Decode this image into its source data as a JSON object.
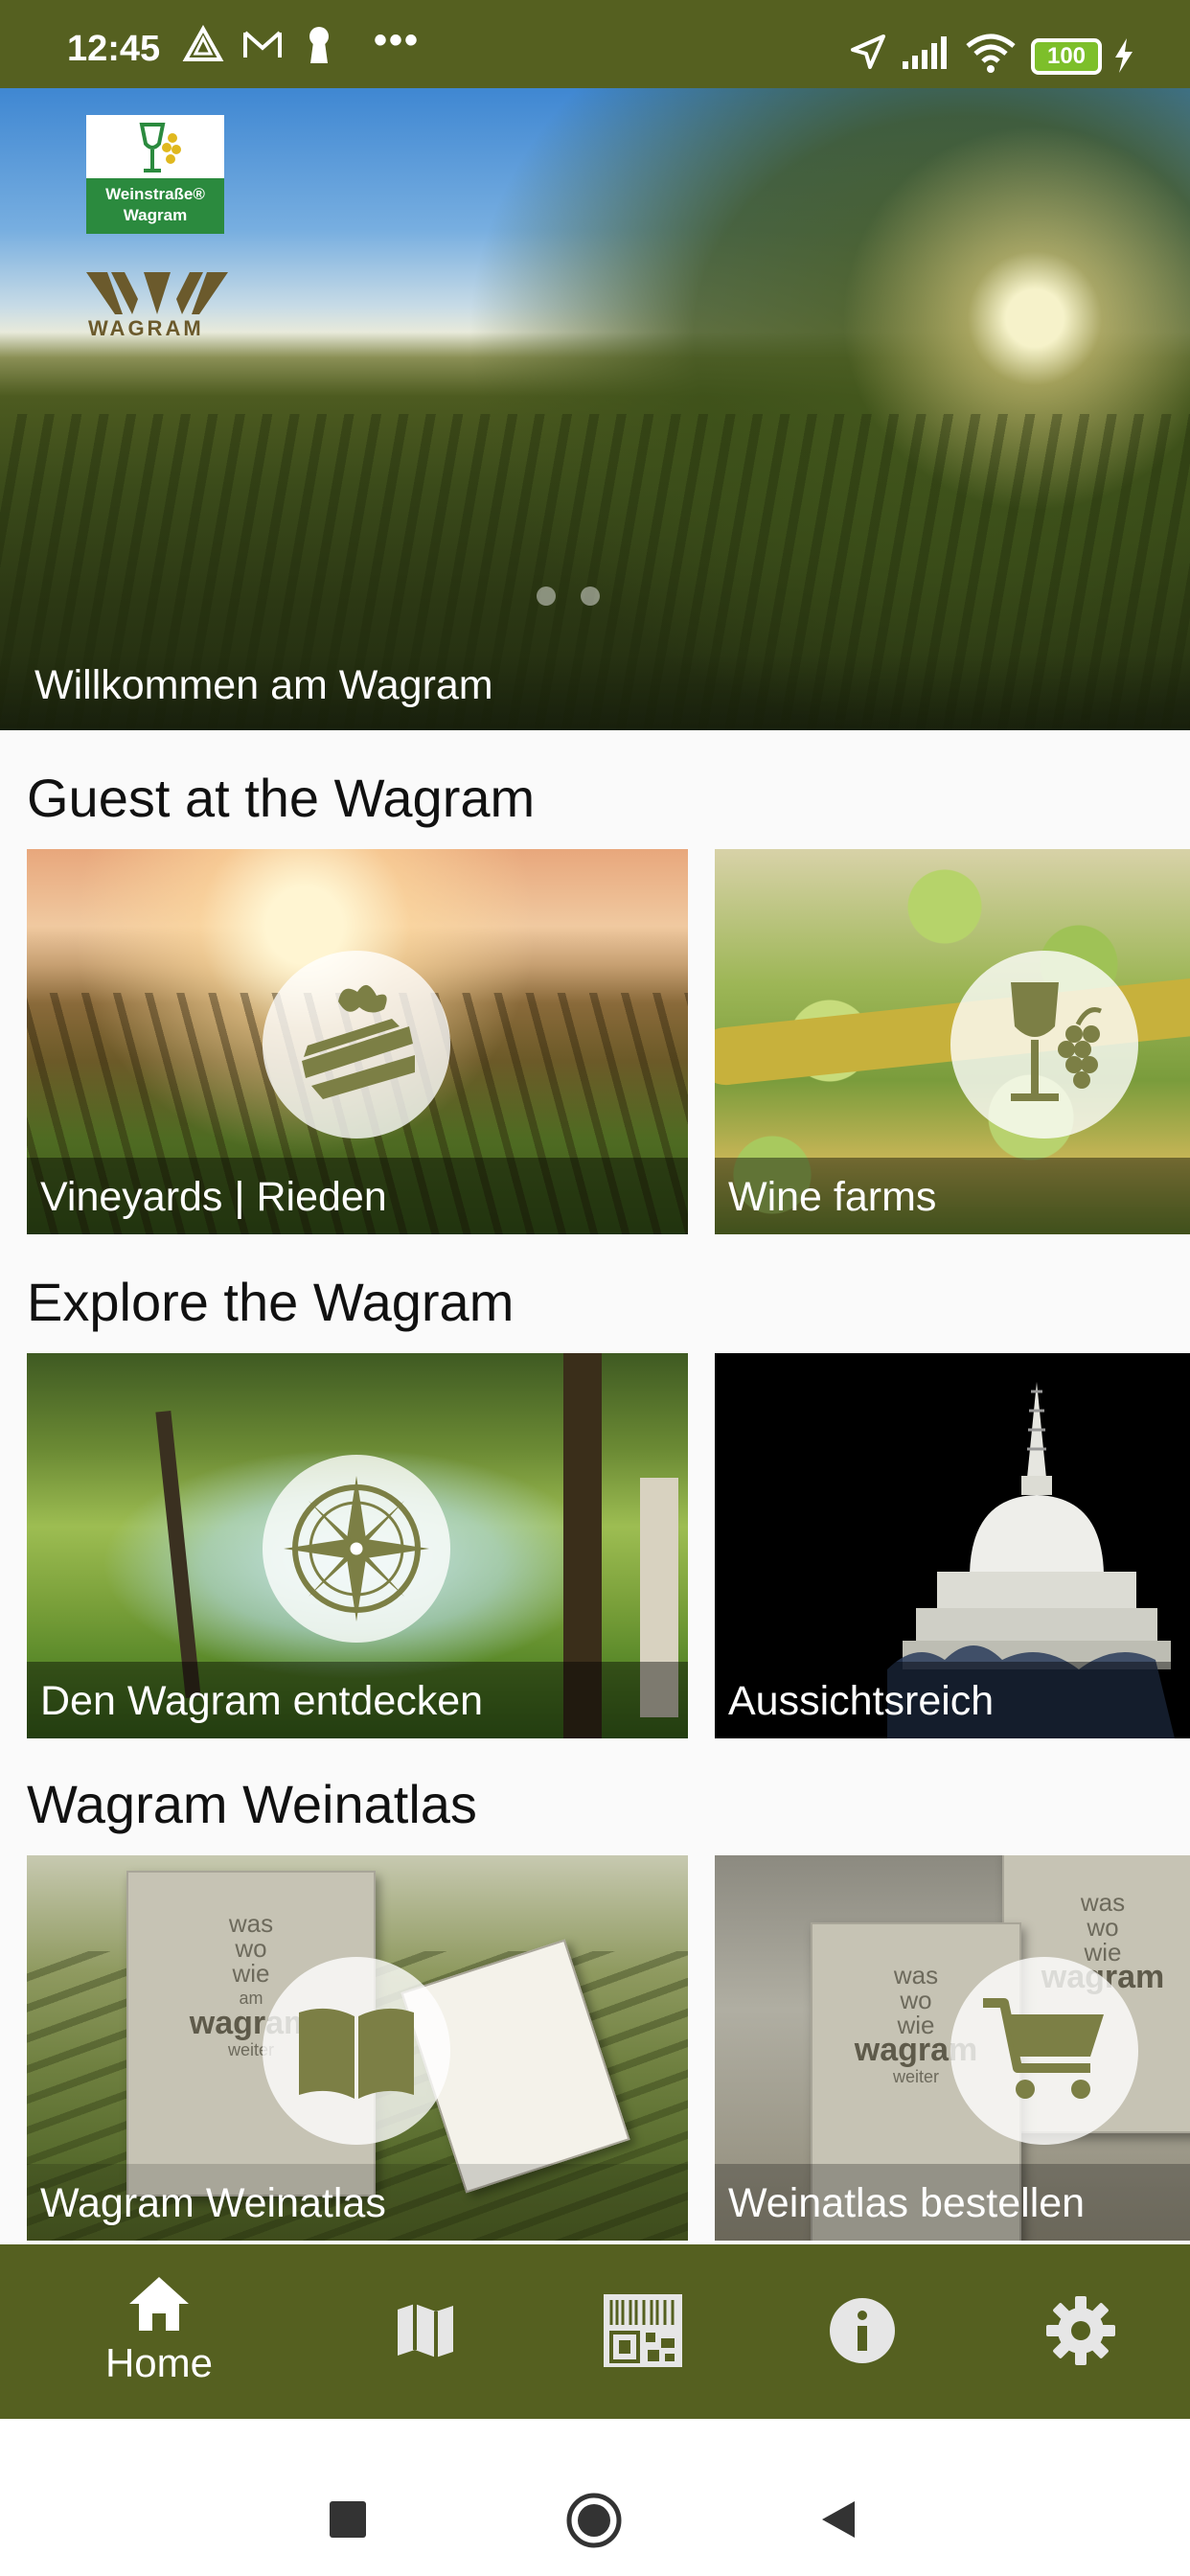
{
  "status_bar": {
    "time": "12:45",
    "dots": "•••",
    "battery": "100",
    "icons": [
      "alert-triangle-icon",
      "gmail-icon",
      "keyhole-icon",
      "location-arrow-icon",
      "signal-icon",
      "wifi-icon",
      "battery-icon",
      "charging-bolt-icon"
    ]
  },
  "hero": {
    "caption": "Willkommen am Wagram",
    "logo_text_line1": "Weinstraße®",
    "logo_text_line2": "Wagram",
    "brand": "WAGRAM",
    "slides": 2
  },
  "sections": [
    {
      "title": "Guest at the Wagram",
      "tiles": [
        {
          "label": "Vineyards | Rieden",
          "icon": "vineyard-icon"
        },
        {
          "label": "Wine farms",
          "icon": "wine-glass-grapes-icon"
        }
      ]
    },
    {
      "title": "Explore the Wagram",
      "tiles": [
        {
          "label": "Den Wagram entdecken",
          "icon": "compass-icon"
        },
        {
          "label": "Aussichtsreich",
          "icon": ""
        }
      ]
    },
    {
      "title": "Wagram Weinatlas",
      "tiles": [
        {
          "label": "Wagram Weinatlas",
          "icon": "open-book-icon"
        },
        {
          "label": "Weinatlas bestellen",
          "icon": "shopping-cart-icon"
        }
      ]
    }
  ],
  "book_cover": {
    "line1": "was",
    "line2": "wo",
    "line3": "wie",
    "line4": "am",
    "line5": "wagram",
    "line6": "weiter"
  },
  "bottom_nav": {
    "items": [
      {
        "label": "Home",
        "icon": "home-icon",
        "active": true
      },
      {
        "label": "",
        "icon": "map-icon"
      },
      {
        "label": "",
        "icon": "qr-barcode-icon"
      },
      {
        "label": "",
        "icon": "info-icon"
      },
      {
        "label": "",
        "icon": "settings-gear-icon"
      }
    ]
  },
  "system_nav": [
    "recents-square-icon",
    "home-circle-icon",
    "back-triangle-icon"
  ],
  "colors": {
    "brand_olive": "#556020",
    "icon_olive": "#7c7f45",
    "nav_icon_inactive": "#e6e6e6"
  }
}
